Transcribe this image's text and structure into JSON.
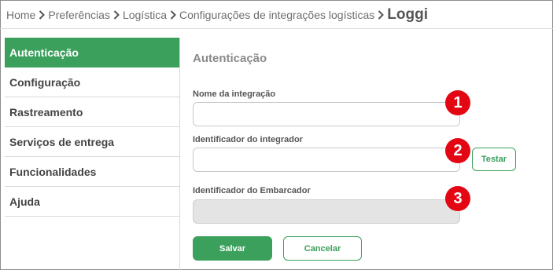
{
  "breadcrumb": {
    "items": [
      "Home",
      "Preferências",
      "Logística",
      "Configurações de integrações logísticas"
    ],
    "current": "Loggi"
  },
  "sidebar": {
    "items": [
      {
        "label": "Autenticação",
        "active": true
      },
      {
        "label": "Configuração"
      },
      {
        "label": "Rastreamento"
      },
      {
        "label": "Serviços de entrega"
      },
      {
        "label": "Funcionalidades"
      },
      {
        "label": "Ajuda"
      }
    ]
  },
  "main": {
    "title": "Autenticação",
    "fields": [
      {
        "label": "Nome da integração",
        "value": "",
        "badge": "1"
      },
      {
        "label": "Identificador do integrador",
        "value": "",
        "badge": "2"
      },
      {
        "label": "Identificador do Embarcador",
        "value": "",
        "badge": "3",
        "disabled": true
      }
    ],
    "test_label": "Testar",
    "save_label": "Salvar",
    "cancel_label": "Cancelar"
  },
  "colors": {
    "accent": "#3aa05c",
    "badge": "#e30613"
  }
}
